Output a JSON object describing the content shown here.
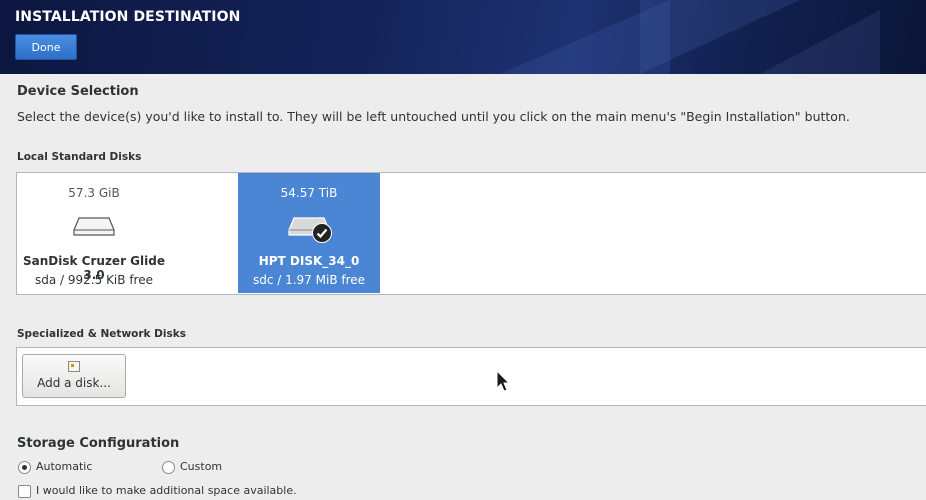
{
  "header": {
    "title": "INSTALLATION DESTINATION",
    "done_label": "Done"
  },
  "device_selection": {
    "title": "Device Selection",
    "description": "Select the device(s) you'd like to install to.  They will be left untouched until you click on the main menu's \"Begin Installation\" button."
  },
  "local_disks": {
    "heading": "Local Standard Disks",
    "disks": [
      {
        "size": "57.3 GiB",
        "name": "SanDisk Cruzer Glide 3.0",
        "free": "sda  /  992.5 KiB free",
        "selected": false,
        "icon": "hard-drive-icon"
      },
      {
        "size": "54.57 TiB",
        "name": "HPT DISK_34_0",
        "free": "sdc / 1.97 MiB free",
        "selected": true,
        "icon": "hard-drive-icon"
      }
    ]
  },
  "network_disks": {
    "heading": "Specialized & Network Disks",
    "add_label": "Add a disk...",
    "add_icon": "add-disk-icon"
  },
  "storage": {
    "title": "Storage Configuration",
    "automatic_label": "Automatic",
    "custom_label": "Custom",
    "selected": "Automatic",
    "space_label": "I would like to make additional space available."
  },
  "colors": {
    "header_bg": "#14245a",
    "accent": "#4a86d4",
    "page_bg": "#ededed"
  }
}
